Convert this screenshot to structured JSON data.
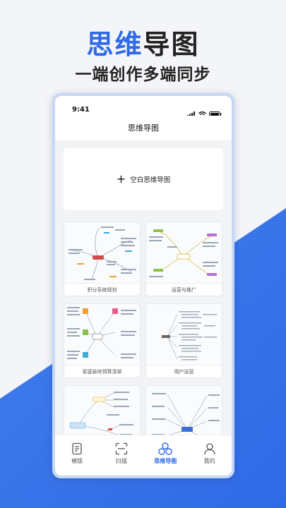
{
  "promo": {
    "title_highlight": "思维",
    "title_rest": "导图",
    "subtitle": "一端创作多端同步"
  },
  "status_bar": {
    "time": "9:41"
  },
  "nav": {
    "title": "思维导图"
  },
  "blank_card": {
    "label": "空白思维导图"
  },
  "templates": [
    {
      "label": "积分系统规划"
    },
    {
      "label": "运营与推广"
    },
    {
      "label": "家庭装修预算清单"
    },
    {
      "label": "用户运营"
    },
    {
      "label": ""
    },
    {
      "label": ""
    }
  ],
  "tabs": [
    {
      "label": "模版",
      "icon": "template-icon"
    },
    {
      "label": "扫描",
      "icon": "scan-icon"
    },
    {
      "label": "思维导图",
      "icon": "mindmap-icon"
    },
    {
      "label": "我的",
      "icon": "profile-icon"
    }
  ],
  "colors": {
    "accent": "#2f6ae6",
    "background": "#f4f5f8"
  }
}
